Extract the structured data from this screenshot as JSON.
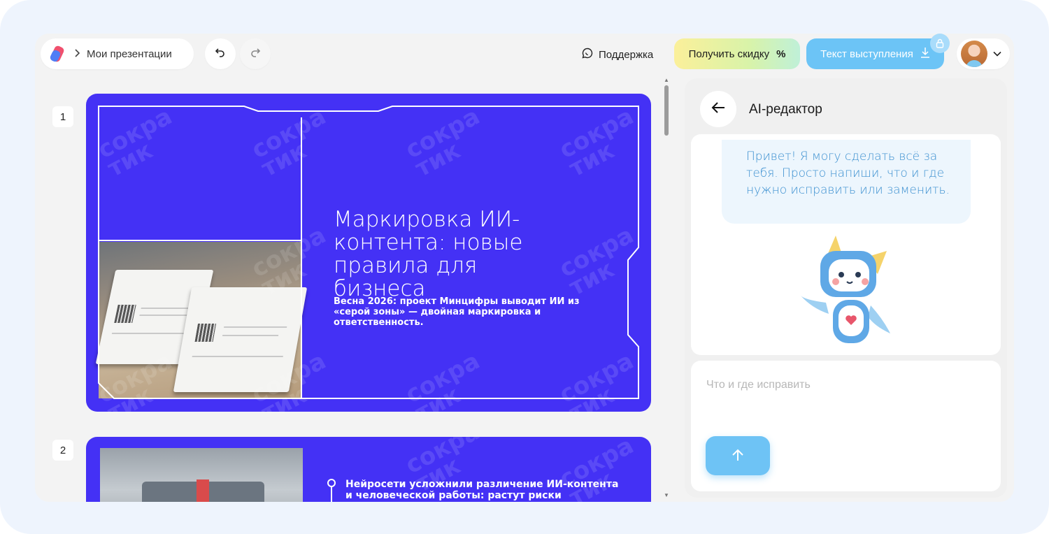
{
  "header": {
    "breadcrumb_label": "Мои презентации",
    "support_label": "Поддержка",
    "discount_label": "Получить скидку",
    "discount_symbol": "%",
    "speech_label": "Текст выступления"
  },
  "slides": [
    {
      "number": "1",
      "title": "Маркировка ИИ-контента: новые правила для бизнеса",
      "subtitle": "Весна 2026: проект Минцифры выводит ИИ из «серой зоны» — двойная маркировка и ответственность."
    },
    {
      "number": "2",
      "text": "Нейросети усложнили различение ИИ-контента и человеческой работы: растут риски манипуляций и"
    }
  ],
  "watermark": {
    "line1": "сокра",
    "line2": "тик"
  },
  "ai_panel": {
    "title": "AI-редактор",
    "greeting": "Привет! Я могу сделать всё за тебя. Просто напиши, что и где нужно исправить или заменить.",
    "input_placeholder": "Что и где исправить"
  },
  "colors": {
    "slide_bg": "#4431f5",
    "accent_blue": "#6cc4f6",
    "bubble_text": "#3a8fd0"
  }
}
